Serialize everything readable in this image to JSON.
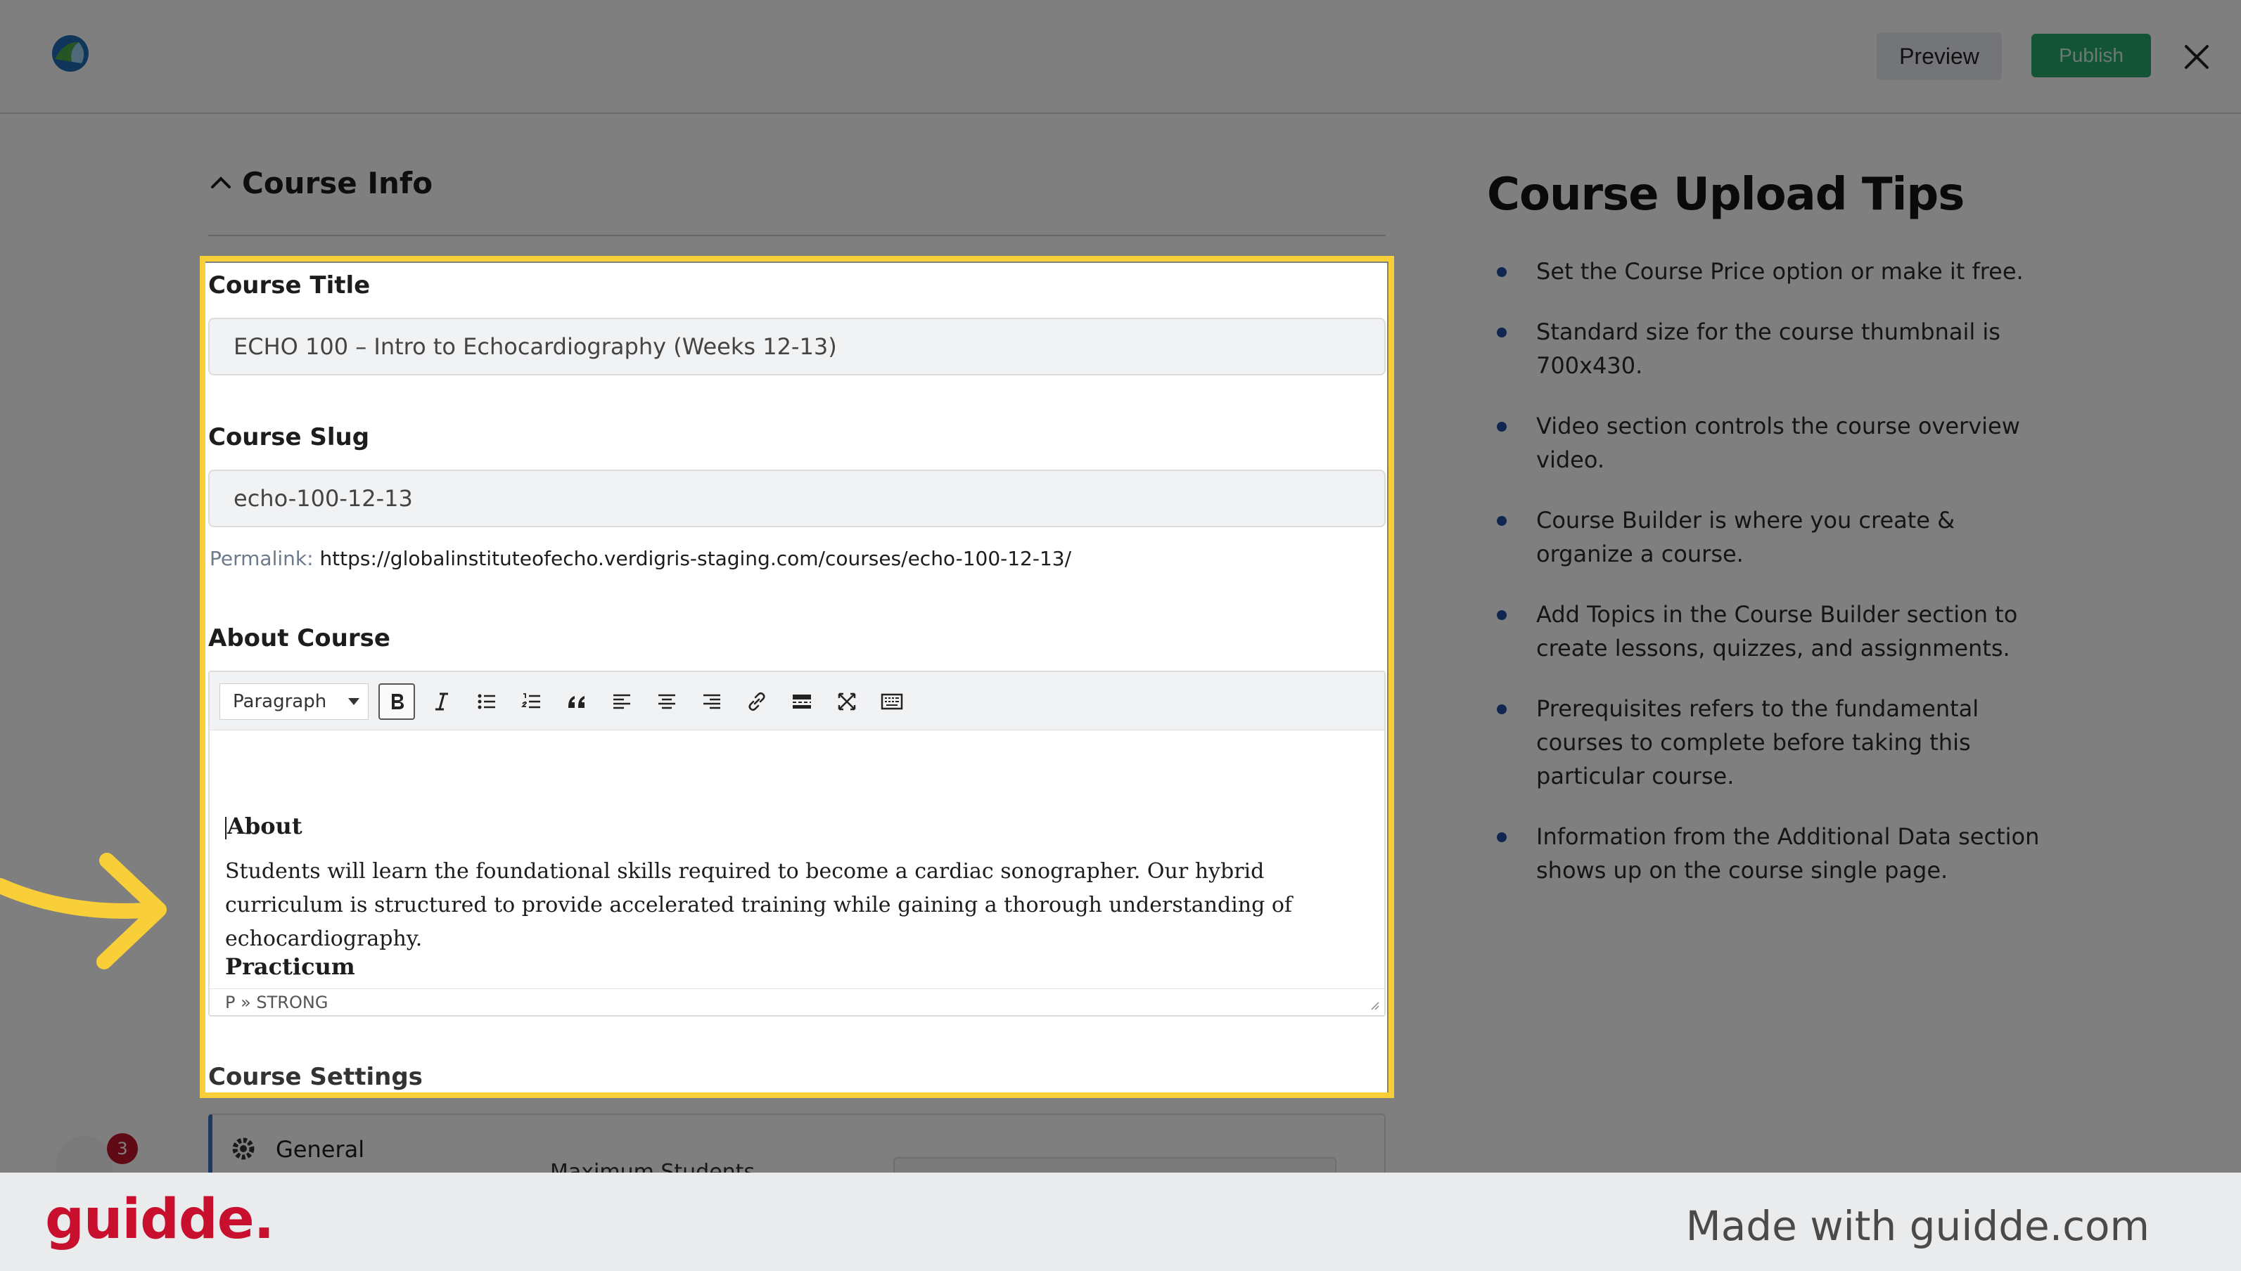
{
  "topbar": {
    "preview_label": "Preview",
    "publish_label": "Publish"
  },
  "course_info": {
    "section_title": "Course Info",
    "title_label": "Course Title",
    "title_value": "ECHO 100 – Intro to Echocardiography (Weeks 12-13)",
    "slug_label": "Course Slug",
    "slug_value": "echo-100-12-13",
    "permalink_label": "Permalink:",
    "permalink_url": "https://globalinstituteofecho.verdigris-staging.com/courses/echo-100-12-13/",
    "about_label": "About Course"
  },
  "editor": {
    "format_select": "Paragraph",
    "heading1": "About",
    "paragraph1": "Students will learn the foundational skills required to become a cardiac sonographer. Our  hybrid curriculum is structured  to provide accelerated training while gaining a thorough understanding of echocardiography.",
    "heading2": "Practicum",
    "status_path": "P » STRONG"
  },
  "settings": {
    "title": "Course Settings",
    "general_tab": "General",
    "max_students_label": "Maximum Students"
  },
  "avatar_badge": "3",
  "tips": {
    "title": "Course Upload Tips",
    "items": [
      "Set the Course Price option or make it free.",
      "Standard size for the course thumbnail is 700x430.",
      "Video section controls the course overview video.",
      "Course Builder is where you create & organize a course.",
      "Add Topics in the Course Builder section to create lessons, quizzes, and assignments.",
      "Prerequisites refers to the fundamental courses to complete before taking this particular course.",
      "Information from the Additional Data section shows up on the course single page."
    ]
  },
  "footer": {
    "brand": "guidde.",
    "made_with": "Made with guidde.com"
  },
  "colors": {
    "highlight": "#f8cf38",
    "publish": "#24a86b",
    "brand": "#c8102e"
  }
}
